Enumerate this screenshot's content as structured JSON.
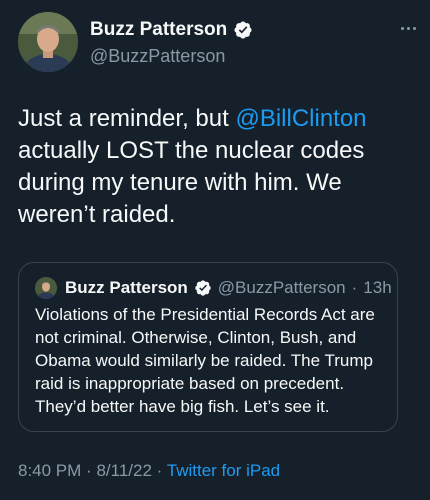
{
  "author": {
    "display_name": "Buzz Patterson",
    "handle": "@BuzzPatterson",
    "verified": true
  },
  "tweet": {
    "text_before": "Just a reminder, but ",
    "mention": "@BillClinton",
    "text_after": " actually LOST the nuclear codes during my tenure with him. We weren’t raided."
  },
  "quoted_tweet": {
    "display_name": "Buzz Patterson",
    "handle": "@BuzzPatterson",
    "separator": "·",
    "time": "13h",
    "text": "Violations of the Presidential Records Act are not criminal. Otherwise, Clinton, Bush, and Obama would similarly be raided. The Trump raid is inappropriate based on precedent. They’d better have big fish. Let’s see it."
  },
  "footer": {
    "time": "8:40 PM",
    "sep1": "·",
    "date": "8/11/22",
    "sep2": "·",
    "source": "Twitter for iPad"
  },
  "icons": {
    "verified": "verified-badge-icon",
    "more": "more-horizontal-icon"
  },
  "colors": {
    "background": "#15202b",
    "text": "#f7f9f9",
    "secondary": "#8b98a5",
    "accent": "#1d9bf0",
    "border": "#38444d"
  }
}
